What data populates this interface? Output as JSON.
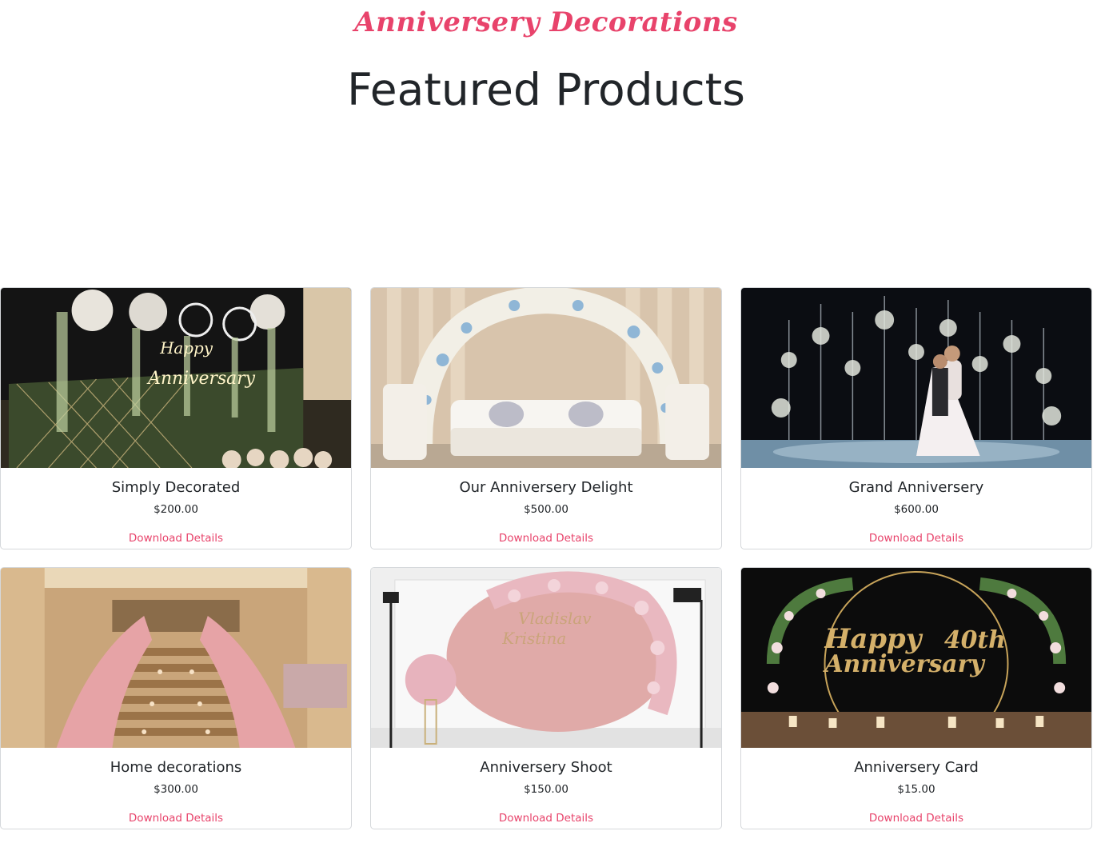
{
  "brand": {
    "title": "Anniversery Decorations",
    "color": "#e8436b"
  },
  "heading": {
    "title": "Featured Products"
  },
  "products": [
    {
      "name": "Simply Decorated",
      "price": "$200.00",
      "link": "Download Details",
      "image_icon": "neon-happy-anniversary-backdrop-image"
    },
    {
      "name": "Our Anniversery Delight",
      "price": "$500.00",
      "link": "Download Details",
      "image_icon": "floral-arch-sofa-image"
    },
    {
      "name": "Grand Anniversery",
      "price": "$600.00",
      "link": "Download Details",
      "image_icon": "couple-floral-stage-image"
    },
    {
      "name": "Home decorations",
      "price": "$300.00",
      "link": "Download Details",
      "image_icon": "floral-staircase-image"
    },
    {
      "name": "Anniversery Shoot",
      "price": "$150.00",
      "link": "Download Details",
      "image_icon": "pink-floral-backdrop-image"
    },
    {
      "name": "Anniversery Card",
      "price": "$15.00",
      "link": "Download Details",
      "image_icon": "happy-40th-anniversary-sign-image"
    }
  ]
}
